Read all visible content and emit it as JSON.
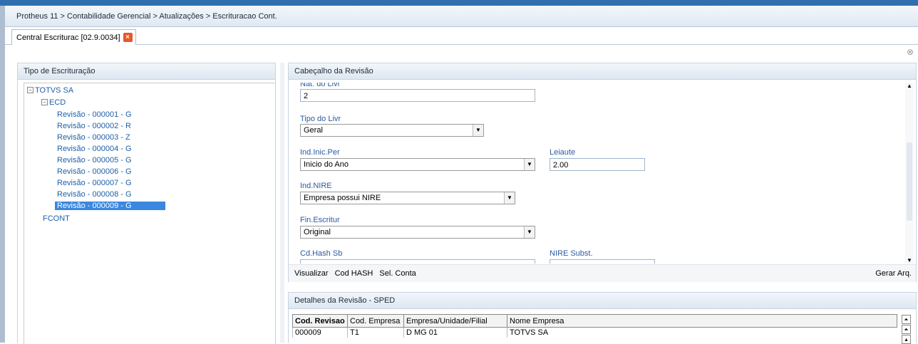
{
  "breadcrumb": "Protheus 11 > Contabilidade Gerencial > Atualizações > Escrituracao Cont.",
  "tab": {
    "label": "Central Escriturac [02.9.0034]",
    "close": "×"
  },
  "left_panel": {
    "title": "Tipo de Escrituração",
    "root": "TOTVS SA",
    "ecd": "ECD",
    "revisions": [
      "Revisão - 000001 - G",
      "Revisão - 000002 - R",
      "Revisão - 000003 - Z",
      "Revisão - 000004 - G",
      "Revisão - 000005 - G",
      "Revisão - 000006 - G",
      "Revisão - 000007 - G",
      "Revisão - 000008 - G",
      "Revisão - 000009 - G"
    ],
    "fcont": "FCONT"
  },
  "header_panel": {
    "title": "Cabeçalho da Revisão",
    "nat_livr_label": "Nat. do Livr",
    "nat_livr_value": "2",
    "tipo_livr_label": "Tipo do Livr",
    "tipo_livr_value": "Geral",
    "ind_inic_label": "Ind.Inic.Per",
    "ind_inic_value": "Inicio do Ano",
    "leiaute_label": "Leiaute",
    "leiaute_value": "2.00",
    "ind_nire_label": "Ind.NIRE",
    "ind_nire_value": "Empresa possui NIRE",
    "fin_escritur_label": "Fin.Escritur",
    "fin_escritur_value": "Original",
    "cd_hash_label": "Cd.Hash Sb",
    "nire_subst_label": "NIRE Subst.",
    "actions": {
      "visualizar": "Visualizar",
      "cod_hash": "Cod HASH",
      "sel_conta": "Sel. Conta",
      "gerar": "Gerar Arq."
    }
  },
  "details_panel": {
    "title": "Detalhes da Revisão - SPED",
    "columns": [
      "Cod. Revisao",
      "Cod. Empresa",
      "Empresa/Unidade/Filial",
      "Nome Empresa"
    ],
    "rows": [
      [
        "000009",
        "T1",
        "D MG 01",
        "TOTVS SA"
      ]
    ]
  }
}
